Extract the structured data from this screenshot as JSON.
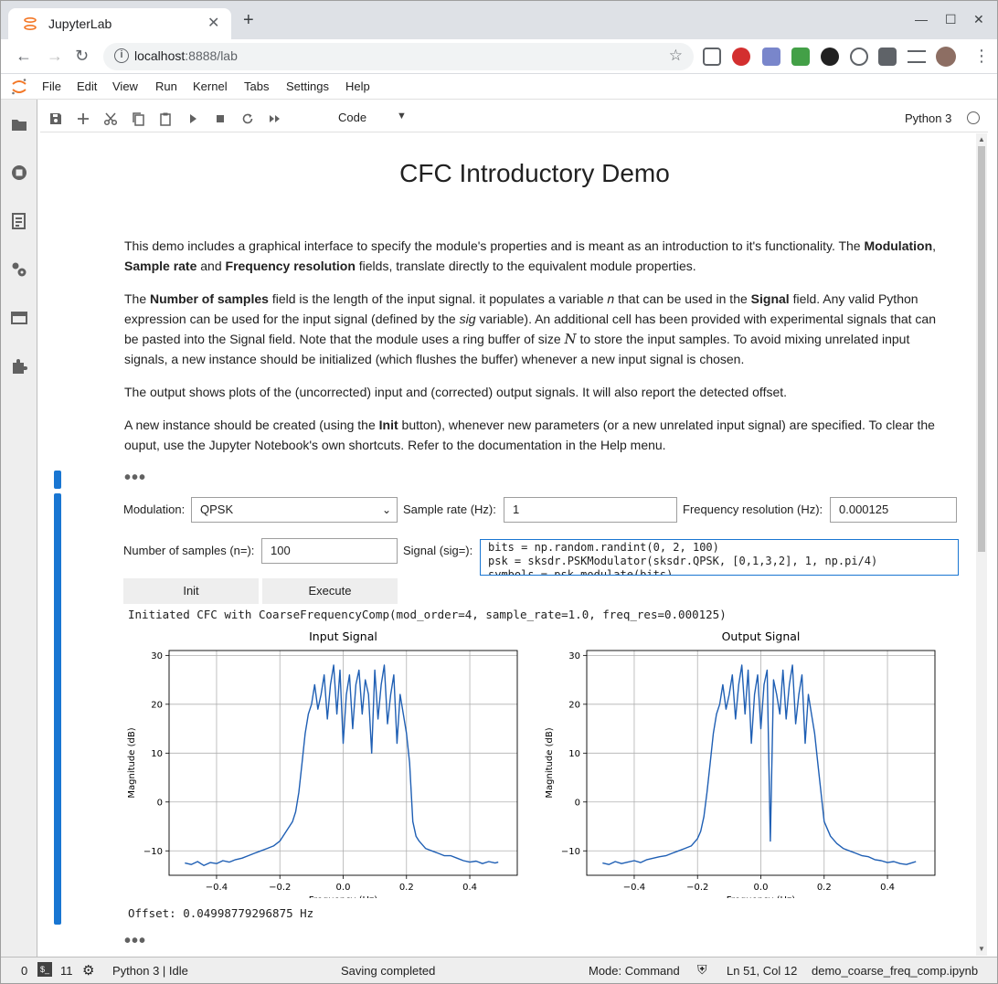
{
  "browser": {
    "tab_title": "JupyterLab",
    "url_host": "localhost",
    "url_rest": ":8888/lab"
  },
  "menubar": [
    "File",
    "Edit",
    "View",
    "Run",
    "Kernel",
    "Tabs",
    "Settings",
    "Help"
  ],
  "notebook_toolbar": {
    "cell_type": "Code",
    "kernel": "Python 3"
  },
  "notebook": {
    "title": "CFC Introductory Demo",
    "para1": {
      "t1": "This demo includes a graphical interface to specify the module's properties and is meant as an introduction to it's functionality. The ",
      "b1": "Modulation",
      "t2": ", ",
      "b2": "Sample rate",
      "t3": " and ",
      "b3": "Frequency resolution",
      "t4": " fields, translate directly to the equivalent module properties."
    },
    "para2": {
      "t1": "The ",
      "b1": "Number of samples",
      "t2": " field is the length of the input signal. it populates a variable ",
      "i1": "n",
      "t3": " that can be used in the ",
      "b2": "Signal",
      "t4": " field. Any valid Python expression can be used for the input signal (defined by the ",
      "i2": "sig",
      "t5": " variable). An additional cell has been provided with experimental signals that can be pasted into the Signal field. Note that the module uses a ring buffer of size ",
      "m1": "N",
      "t6": " to store the input samples. To avoid mixing unrelated input signals, a new instance should be initialized (which flushes the buffer) whenever a new input signal is chosen."
    },
    "para3": "The output shows plots of the (uncorrected) input and (corrected) output signals. It will also report the detected offset.",
    "para4": {
      "t1": "A new instance should be created (using the ",
      "b1": "Init",
      "t2": " button), whenever new parameters (or a new unrelated input signal) are specified. To clear the ouput, use the Jupyter Notebook's own shortcuts. Refer to the documentation in the Help menu."
    },
    "ellipsis": "•••"
  },
  "widgets": {
    "modulation_label": "Modulation:",
    "modulation_value": "QPSK",
    "sample_rate_label": "Sample rate (Hz):",
    "sample_rate_value": "1",
    "freq_res_label": "Frequency resolution (Hz):",
    "freq_res_value": "0.000125",
    "num_samples_label": "Number of samples (n=):",
    "num_samples_value": "100",
    "signal_label": "Signal (sig=):",
    "signal_lines": [
      "bits = np.random.randint(0, 2, 100)",
      "psk = sksdr.PSKModulator(sksdr.QPSK, [0,1,3,2], 1, np.pi/4)",
      "symbols = psk.modulate(bits)"
    ],
    "init_button": "Init",
    "execute_button": "Execute"
  },
  "output": {
    "init_message": "Initiated CFC with CoarseFrequencyComp(mod_order=4, sample_rate=1.0, freq_res=0.000125)",
    "offset_message": "Offset: 0.04998779296875 Hz"
  },
  "chart_data": [
    {
      "type": "line",
      "title": "Input Signal",
      "xlabel": "Frequency (Hz)",
      "ylabel": "Magnitude (dB)",
      "xlim": [
        -0.55,
        0.55
      ],
      "ylim": [
        -15,
        31
      ],
      "xticks": [
        -0.4,
        -0.2,
        0.0,
        0.2,
        0.4
      ],
      "xtick_labels": [
        "−0.4",
        "−0.2",
        "0.0",
        "0.2",
        "0.4"
      ],
      "yticks": [
        -10,
        0,
        10,
        20,
        30
      ],
      "ytick_labels": [
        "−10",
        "0",
        "10",
        "20",
        "30"
      ],
      "grid": true,
      "color": "#1f5fb4",
      "x": [
        -0.5,
        -0.48,
        -0.46,
        -0.44,
        -0.42,
        -0.4,
        -0.38,
        -0.36,
        -0.34,
        -0.32,
        -0.3,
        -0.28,
        -0.26,
        -0.24,
        -0.22,
        -0.2,
        -0.18,
        -0.16,
        -0.15,
        -0.14,
        -0.13,
        -0.12,
        -0.11,
        -0.1,
        -0.09,
        -0.08,
        -0.07,
        -0.06,
        -0.05,
        -0.04,
        -0.03,
        -0.02,
        -0.01,
        0.0,
        0.01,
        0.02,
        0.03,
        0.04,
        0.05,
        0.06,
        0.07,
        0.08,
        0.09,
        0.1,
        0.11,
        0.12,
        0.13,
        0.14,
        0.15,
        0.16,
        0.17,
        0.18,
        0.19,
        0.2,
        0.21,
        0.22,
        0.23,
        0.24,
        0.26,
        0.28,
        0.3,
        0.32,
        0.34,
        0.36,
        0.38,
        0.4,
        0.42,
        0.44,
        0.46,
        0.48,
        0.49
      ],
      "y": [
        -12.5,
        -12.8,
        -12.2,
        -13,
        -12.4,
        -12.6,
        -12,
        -12.3,
        -11.8,
        -11.5,
        -11,
        -10.5,
        -10,
        -9.5,
        -9,
        -8,
        -6,
        -4,
        -2,
        2,
        8,
        14,
        18,
        20,
        24,
        19,
        22,
        26,
        17,
        24,
        28,
        18,
        27,
        12,
        22,
        26,
        15,
        24,
        27,
        18,
        25,
        22,
        10,
        27,
        17,
        24,
        28,
        16,
        22,
        26,
        12,
        22,
        18,
        14,
        8,
        -4,
        -7,
        -8,
        -9.5,
        -10,
        -10.5,
        -11,
        -11,
        -11.5,
        -12,
        -12.3,
        -12.1,
        -12.6,
        -12.2,
        -12.5,
        -12.3
      ]
    },
    {
      "type": "line",
      "title": "Output Signal",
      "xlabel": "Frequency (Hz)",
      "ylabel": "Magnitude (dB)",
      "xlim": [
        -0.55,
        0.55
      ],
      "ylim": [
        -15,
        31
      ],
      "xticks": [
        -0.4,
        -0.2,
        0.0,
        0.2,
        0.4
      ],
      "xtick_labels": [
        "−0.4",
        "−0.2",
        "0.0",
        "0.2",
        "0.4"
      ],
      "yticks": [
        -10,
        0,
        10,
        20,
        30
      ],
      "ytick_labels": [
        "−10",
        "0",
        "10",
        "20",
        "30"
      ],
      "grid": true,
      "color": "#1f5fb4",
      "x": [
        -0.5,
        -0.48,
        -0.46,
        -0.44,
        -0.42,
        -0.4,
        -0.38,
        -0.36,
        -0.34,
        -0.32,
        -0.3,
        -0.28,
        -0.26,
        -0.24,
        -0.22,
        -0.2,
        -0.19,
        -0.18,
        -0.17,
        -0.16,
        -0.15,
        -0.14,
        -0.13,
        -0.12,
        -0.11,
        -0.1,
        -0.09,
        -0.08,
        -0.07,
        -0.06,
        -0.05,
        -0.04,
        -0.03,
        -0.02,
        -0.01,
        0.0,
        0.01,
        0.02,
        0.03,
        0.04,
        0.05,
        0.06,
        0.07,
        0.08,
        0.09,
        0.1,
        0.11,
        0.12,
        0.13,
        0.14,
        0.15,
        0.16,
        0.17,
        0.18,
        0.19,
        0.2,
        0.22,
        0.24,
        0.26,
        0.28,
        0.3,
        0.32,
        0.34,
        0.36,
        0.38,
        0.4,
        0.42,
        0.44,
        0.46,
        0.48,
        0.49
      ],
      "y": [
        -12.5,
        -12.8,
        -12.2,
        -12.6,
        -12.3,
        -12,
        -12.4,
        -11.8,
        -11.5,
        -11.2,
        -11,
        -10.5,
        -10,
        -9.5,
        -9,
        -7.5,
        -6,
        -3,
        2,
        8,
        14,
        18,
        20,
        24,
        19,
        22,
        26,
        17,
        24,
        28,
        18,
        27,
        12,
        22,
        26,
        15,
        24,
        27,
        -8,
        25,
        22,
        18,
        27,
        17,
        24,
        28,
        16,
        22,
        26,
        12,
        22,
        18,
        14,
        8,
        2,
        -4,
        -7,
        -8.5,
        -9.5,
        -10,
        -10.5,
        -11,
        -11.2,
        -11.8,
        -12,
        -12.4,
        -12.2,
        -12.6,
        -12.8,
        -12.4,
        -12.2
      ]
    }
  ],
  "statusbar": {
    "terminals": "0",
    "kernels": "11",
    "kernel_status": "Python 3 | Idle",
    "saving": "Saving completed",
    "mode": "Mode: Command",
    "position": "Ln 51, Col 12",
    "filename": "demo_coarse_freq_comp.ipynb"
  }
}
